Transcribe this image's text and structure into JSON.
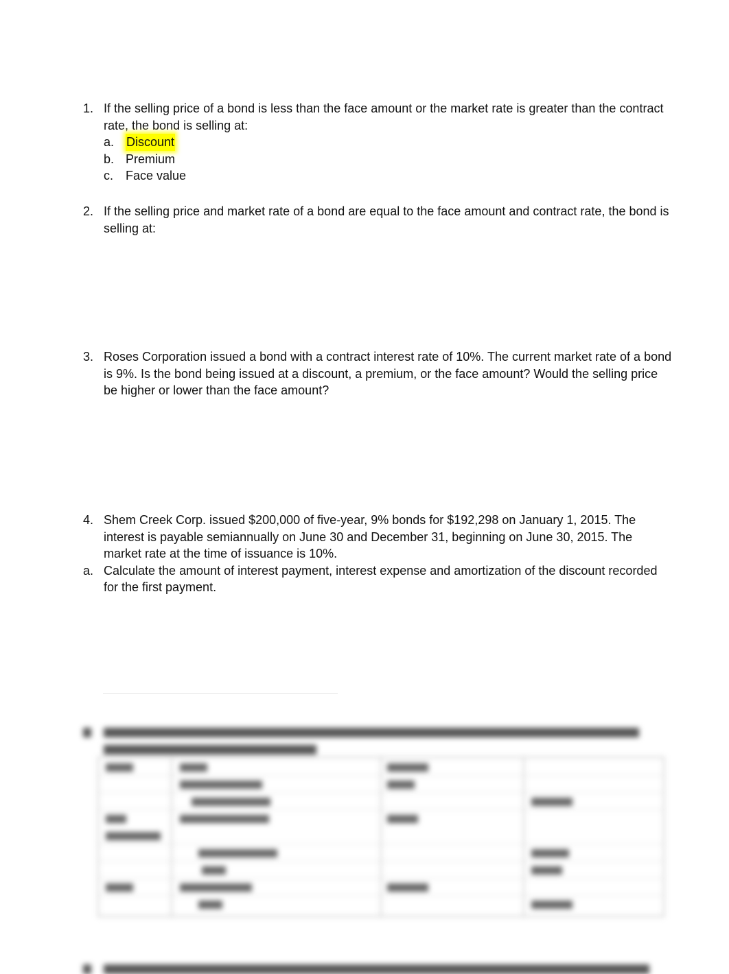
{
  "questions": [
    {
      "number": "1.",
      "text": "If the selling price of a bond is less than the face amount or the market rate is greater than the contract rate, the bond is selling at:",
      "options": [
        {
          "letter": "a.",
          "text": "Discount",
          "highlighted": true
        },
        {
          "letter": "b.",
          "text": "Premium",
          "highlighted": false
        },
        {
          "letter": "c.",
          "text": "Face value",
          "highlighted": false
        }
      ]
    },
    {
      "number": "2.",
      "text": "If the selling price and market rate of a bond are equal to the face amount and contract rate, the bond is selling at:"
    },
    {
      "number": "3.",
      "text": "Roses Corporation issued a bond with a contract interest rate of 10%. The current market rate of a bond is 9%. Is the bond being issued at a discount, a premium, or the face amount? Would the selling price be higher or lower than the face amount?"
    },
    {
      "number": "4.",
      "text": "Shem Creek Corp. issued $200,000 of five-year, 9% bonds for $192,298 on January 1, 2015. The interest is payable semiannually on June 30 and December 31, beginning on June 30, 2015. The market rate at the time of issuance is 10%.",
      "sub": {
        "letter": "a.",
        "text": "Calculate the amount of interest payment, interest expense and amortization of the discount recorded for the first payment."
      }
    }
  ],
  "colors": {
    "highlight": "#ffff00",
    "text": "#111111"
  }
}
